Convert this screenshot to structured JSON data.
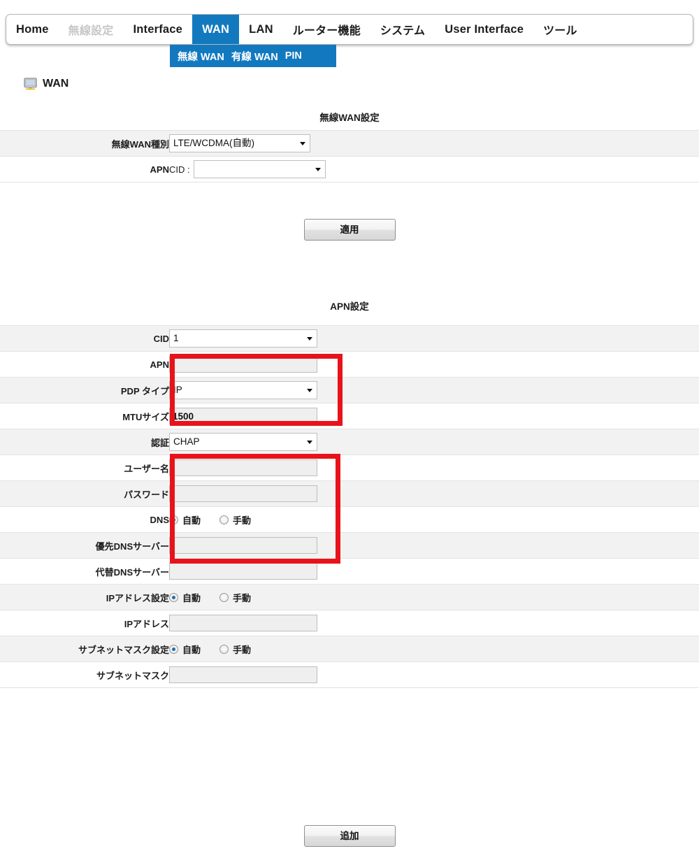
{
  "nav": {
    "items": [
      {
        "label": "Home",
        "state": "normal"
      },
      {
        "label": "無線設定",
        "state": "disabled"
      },
      {
        "label": "Interface",
        "state": "normal"
      },
      {
        "label": "WAN",
        "state": "active"
      },
      {
        "label": "LAN",
        "state": "normal"
      },
      {
        "label": "ルーター機能",
        "state": "normal"
      },
      {
        "label": "システム",
        "state": "normal"
      },
      {
        "label": "User Interface",
        "state": "normal"
      },
      {
        "label": "ツール",
        "state": "normal"
      }
    ],
    "submenu": [
      {
        "label": "無線 WAN"
      },
      {
        "label": "有線 WAN"
      },
      {
        "label": "PIN"
      }
    ],
    "active_color": "#1279bf"
  },
  "page": {
    "icon": "monitor-icon",
    "title": "WAN"
  },
  "section1": {
    "heading": "無線WAN設定",
    "rows": [
      {
        "label": "無線WAN種別",
        "value": "LTE/WCDMA(自動)"
      },
      {
        "label": "APN",
        "prefix": "CID :",
        "value": ""
      }
    ],
    "apply_button": "適用"
  },
  "section2": {
    "heading": "APN設定",
    "rows": [
      {
        "label": "CID",
        "type": "select",
        "value": "1"
      },
      {
        "label": "APN",
        "type": "text",
        "value": ""
      },
      {
        "label": "PDP タイプ",
        "type": "select",
        "value": "IP"
      },
      {
        "label": "MTUサイズ",
        "type": "text",
        "value": "1500"
      },
      {
        "label": "認証",
        "type": "select",
        "value": "CHAP"
      },
      {
        "label": "ユーザー名",
        "type": "text",
        "value": ""
      },
      {
        "label": "パスワード",
        "type": "text",
        "value": ""
      },
      {
        "label": "DNS",
        "type": "radio",
        "options": [
          "自動",
          "手動"
        ],
        "selected": "自動"
      },
      {
        "label": "優先DNSサーバー",
        "type": "text",
        "value": ""
      },
      {
        "label": "代替DNSサーバー",
        "type": "text",
        "value": ""
      },
      {
        "label": "IPアドレス設定",
        "type": "radio",
        "options": [
          "自動",
          "手動"
        ],
        "selected": "自動"
      },
      {
        "label": "IPアドレス",
        "type": "text",
        "value": ""
      },
      {
        "label": "サブネットマスク設定",
        "type": "radio",
        "options": [
          "自動",
          "手動"
        ],
        "selected": "自動"
      },
      {
        "label": "サブネットマスク",
        "type": "text",
        "value": ""
      }
    ],
    "add_button": "追加"
  },
  "annotations": {
    "color": "#e8131a",
    "boxes": [
      {
        "name": "apn-pdp-highlight",
        "covers": [
          "APN",
          "PDP タイプ"
        ]
      },
      {
        "name": "auth-credentials-highlight",
        "covers": [
          "認証",
          "ユーザー名",
          "パスワード"
        ]
      }
    ]
  }
}
